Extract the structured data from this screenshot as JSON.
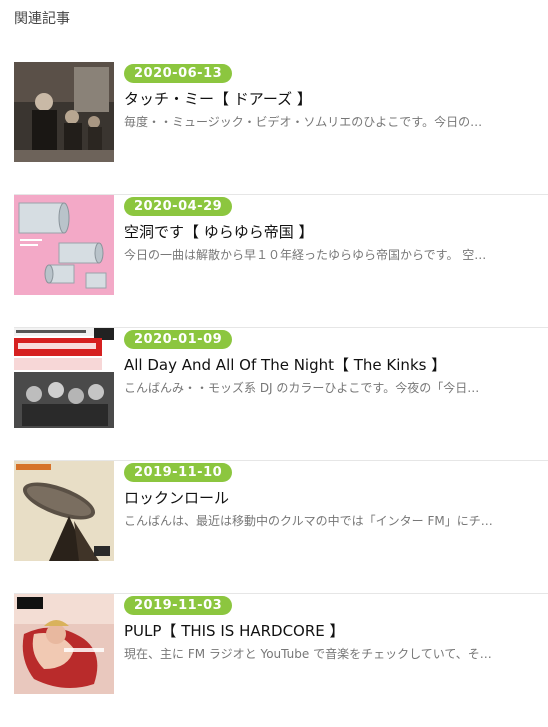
{
  "section_title": "関連記事",
  "articles": [
    {
      "date": "2020-06-13",
      "title": "タッチ・ミー【 ドアーズ 】",
      "excerpt": "毎度・・ミュージック・ビデオ・ソムリエのひよこです。今日の…",
      "thumb_icon": "album-cover-doors"
    },
    {
      "date": "2020-04-29",
      "title": "空洞です【 ゆらゆら帝国 】",
      "excerpt": "今日の一曲は解散から早１０年経ったゆらゆら帝国からです。 空…",
      "thumb_icon": "album-cover-kudo"
    },
    {
      "date": "2020-01-09",
      "title": "All Day And All Of The Night【 The Kinks 】",
      "excerpt": "こんばんみ・・モッズ系 DJ のカラーひよこです。今夜の「今日…",
      "thumb_icon": "album-cover-kinks"
    },
    {
      "date": "2019-11-10",
      "title": "ロックンロール",
      "excerpt": "こんばんは、最近は移動中のクルマの中では「インター FM」にチ…",
      "thumb_icon": "album-cover-zeppelin"
    },
    {
      "date": "2019-11-03",
      "title": "PULP【 THIS IS HARDCORE 】",
      "excerpt": "現在、主に FM ラジオと YouTube で音楽をチェックしていて、そ…",
      "thumb_icon": "album-cover-pulp"
    }
  ],
  "colors": {
    "badge": "#8cc63f",
    "title": "#111111",
    "excerpt": "#777777"
  }
}
